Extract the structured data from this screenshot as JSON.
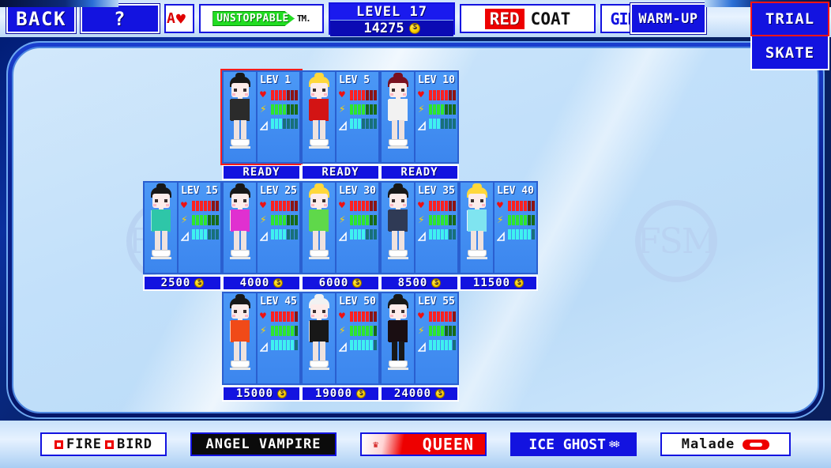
{
  "header": {
    "back_label": "BACK",
    "help_label": "?",
    "heart_plate": {
      "clip_text": "A",
      "icon": "heart-icon"
    },
    "unstoppable": {
      "badge": "UNSTOPPABLE",
      "tail": "TM."
    },
    "level": {
      "title": "LEVEL 17",
      "coins": "14275",
      "coin_icon": "coin-icon"
    },
    "redcoat": {
      "red_word": "RED",
      "dark_word": "COAT"
    },
    "gir_plate": "GIR",
    "warmup_label": "WARM-UP",
    "trial_label": "TRIAL",
    "skate_label": "SKATE"
  },
  "panel": {
    "watermark": "FSM",
    "watermark_left": "FSM",
    "watermark_right": "FSM"
  },
  "stat_icons": {
    "health": "heart-icon",
    "speed": "lightning-icon",
    "jump": "ramp-icon"
  },
  "colors": {
    "accent_blue": "#1313e0",
    "selected_red": "#ff1c1c",
    "health_bar": "#ee1111",
    "speed_bar": "#22dd22",
    "jump_bar": "#2fe3e3",
    "ice_bg": "#c2e0fa",
    "panel_border": "#0a1f90"
  },
  "rows": [
    {
      "id": "row-top",
      "cards": [
        {
          "level": "LEV 1",
          "action": "READY",
          "selected": true,
          "locked": false,
          "stats": {
            "health": 4,
            "speed": 4,
            "jump": 3
          },
          "art": {
            "hair": "#181818",
            "bun": "#181818",
            "top": "#2b2b2b",
            "bottom": "#ee1111",
            "legs": "#efe2de",
            "arm": "#2b2b2b"
          }
        },
        {
          "level": "LEV 5",
          "action": "READY",
          "selected": false,
          "locked": false,
          "stats": {
            "health": 4,
            "speed": 4,
            "jump": 3
          },
          "art": {
            "hair": "#ffd83b",
            "bun": "#ffd83b",
            "top": "#d31414",
            "bottom": "#d31414",
            "legs": "#efe2de",
            "arm": "#d31414"
          }
        },
        {
          "level": "LEV 10",
          "action": "READY",
          "selected": false,
          "locked": false,
          "stats": {
            "health": 5,
            "speed": 4,
            "jump": 3
          },
          "art": {
            "hair": "#7a1020",
            "bun": "#7a1020",
            "top": "#f2f2f2",
            "bottom": "#f2f2f2",
            "legs": "#efe2de",
            "arm": "#f2f2f2"
          }
        }
      ]
    },
    {
      "id": "row-mid",
      "cards": [
        {
          "level": "LEV 15",
          "action": "2500",
          "selected": false,
          "locked": true,
          "stats": {
            "health": 5,
            "speed": 4,
            "jump": 4
          },
          "art": {
            "hair": "#181818",
            "bun": "#181818",
            "top": "#2ec6a8",
            "bottom": "#2ec6a8",
            "legs": "#efe2de",
            "arm": "#9de8dc"
          }
        },
        {
          "level": "LEV 25",
          "action": "4000",
          "selected": false,
          "locked": true,
          "stats": {
            "health": 5,
            "speed": 4,
            "jump": 4
          },
          "art": {
            "hair": "#181818",
            "bun": "#181818",
            "top": "#e030d0",
            "bottom": "#181818",
            "legs": "#efe2de",
            "arm": "#f2eae6"
          }
        },
        {
          "level": "LEV 30",
          "action": "6000",
          "selected": false,
          "locked": true,
          "stats": {
            "health": 5,
            "speed": 5,
            "jump": 4
          },
          "art": {
            "hair": "#ffd83b",
            "bun": "#ffd83b",
            "top": "#5fd84a",
            "bottom": "#5fd84a",
            "legs": "#efe2de",
            "arm": "#5fd84a"
          }
        },
        {
          "level": "LEV 35",
          "action": "8500",
          "selected": false,
          "locked": true,
          "stats": {
            "health": 5,
            "speed": 5,
            "jump": 5
          },
          "art": {
            "hair": "#181818",
            "bun": "#181818",
            "top": "#2f3a55",
            "bottom": "#2f3a55",
            "legs": "#efe2de",
            "arm": "#2f3a55"
          }
        },
        {
          "level": "LEV 40",
          "action": "11500",
          "selected": false,
          "locked": true,
          "stats": {
            "health": 5,
            "speed": 5,
            "jump": 6
          },
          "art": {
            "hair": "#ffd83b",
            "bun": "#ffd83b",
            "top": "#7fe4f0",
            "bottom": "#7fe4f0",
            "legs": "#efe2de",
            "arm": "#eef6f8"
          }
        }
      ]
    },
    {
      "id": "row-bot",
      "cards": [
        {
          "level": "LEV 45",
          "action": "15000",
          "selected": false,
          "locked": true,
          "stats": {
            "health": 6,
            "speed": 6,
            "jump": 6
          },
          "art": {
            "hair": "#181818",
            "bun": "#181818",
            "top": "#f04a18",
            "bottom": "#f04a18",
            "legs": "#efe2de",
            "arm": "#f6cdb8"
          }
        },
        {
          "level": "LEV 50",
          "action": "19000",
          "selected": false,
          "locked": true,
          "stats": {
            "health": 5,
            "speed": 6,
            "jump": 6
          },
          "art": {
            "hair": "#f2f2f2",
            "bun": "#f2f2f2",
            "top": "#181818",
            "bottom": "#e8e8e8",
            "legs": "#efe2de",
            "arm": "#e8e8e8"
          }
        },
        {
          "level": "LEV 55",
          "action": "24000",
          "selected": false,
          "locked": true,
          "stats": {
            "health": 6,
            "speed": 4,
            "jump": 6
          },
          "art": {
            "hair": "#181818",
            "bun": "#181818",
            "top": "#1a0e12",
            "bottom": "#5a0a14",
            "legs": "#181818",
            "arm": "#1a0e12"
          }
        }
      ]
    }
  ],
  "bottom": {
    "brands": [
      {
        "name": "FIRE BIRD",
        "part1": "FIRE",
        "part2": "BIRD",
        "style": "firebird"
      },
      {
        "name": "ANGEL VAMPIRE",
        "label": "ANGEL VAMPIRE",
        "style": "angel"
      },
      {
        "name": "QUEEN",
        "label": "QUEEN",
        "style": "queen"
      },
      {
        "name": "ICE GHOST",
        "label": "ICE GHOST",
        "snow": "***",
        "style": "ice"
      },
      {
        "name": "Malade",
        "label": "Malade",
        "style": "malade"
      }
    ]
  }
}
